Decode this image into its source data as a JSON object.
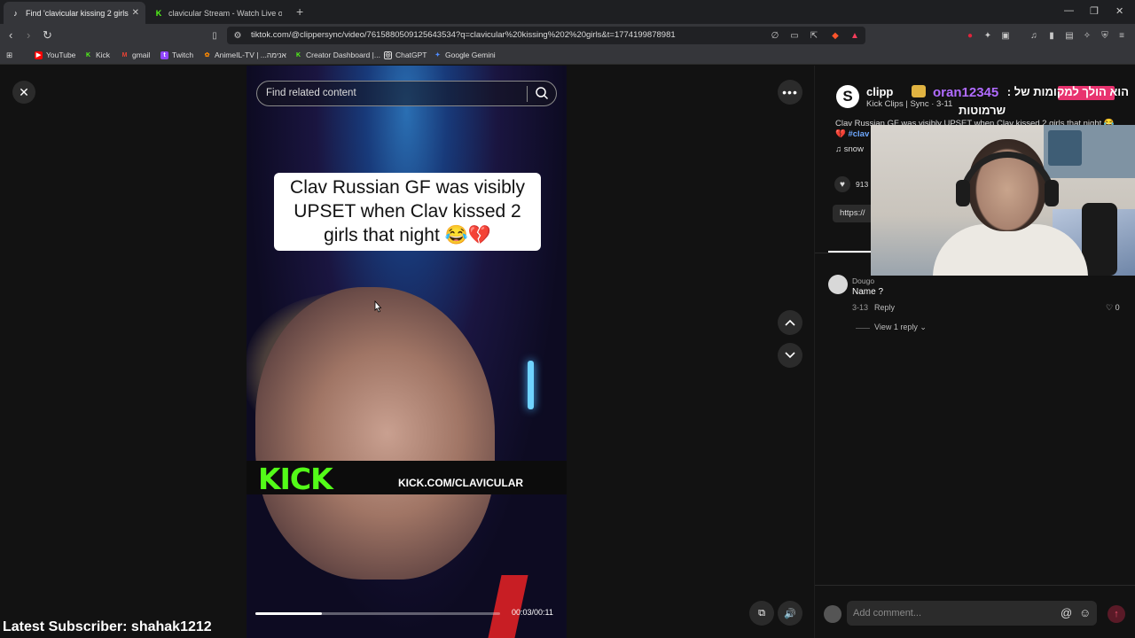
{
  "browser": {
    "tabs": [
      {
        "title": "Find 'clavicular kissing 2 girls",
        "active": true,
        "icon": "tiktok-icon"
      },
      {
        "title": "clavicular Stream - Watch Live on Kic",
        "active": false,
        "icon": "kick-icon"
      }
    ],
    "url": "tiktok.com/@clippersync/video/7615880509125643534?q=clavicular%20kissing%202%20girls&t=1774199878981",
    "bookmarks": [
      {
        "label": "YouTube",
        "icon": "youtube-icon",
        "color": "#ff0000"
      },
      {
        "label": "Kick",
        "icon": "kick-icon",
        "color": "#53fc18"
      },
      {
        "label": "gmail",
        "icon": "gmail-icon",
        "color": "#ea4335"
      },
      {
        "label": "Twitch",
        "icon": "twitch-icon",
        "color": "#9146ff"
      },
      {
        "label": "AnimeIL-TV | ...אנימה",
        "icon": "animeil-icon",
        "color": "#ff8a00"
      },
      {
        "label": "Creator Dashboard |...",
        "icon": "kick-icon",
        "color": "#53fc18"
      },
      {
        "label": "ChatGPT",
        "icon": "chatgpt-icon",
        "color": "#ffffff"
      },
      {
        "label": "Google Gemini",
        "icon": "gemini-icon",
        "color": "#4f8cff"
      }
    ]
  },
  "video": {
    "search_placeholder": "Find related content",
    "caption": "Clav Russian GF was visibly UPSET when Clav kissed 2 girls that night 😂💔",
    "kick_logo": "KICK",
    "kick_url": "KICK.COM/CLAVICULAR",
    "time": "00:03/00:11",
    "progress_fraction": 0.27
  },
  "overlay": {
    "latest_subscriber": "Latest Subscriber: shahak1212"
  },
  "post": {
    "author": "clipp",
    "meta": "Kick Clips | Sync · 3-11",
    "description": "Clav Russian GF was visibly UPSET when Clav kissed 2 girls that night 😂",
    "hashtag": "💔 #clav",
    "music": "♫ snow",
    "likes": "913",
    "link": "https://"
  },
  "stream_overlay": {
    "username": "oran12345",
    "hebrew_line1": "הוא הולך למקומות של :",
    "hebrew_line2": "שרמוטות"
  },
  "comments": [
    {
      "user": "Dougo",
      "text": "Name ?",
      "date": "3-13",
      "reply_label": "Reply",
      "likes": "0",
      "view_replies": "View 1 reply"
    }
  ],
  "comment_bar": {
    "placeholder": "Add comment..."
  },
  "colors": {
    "accent": "#fe2c55",
    "kick_green": "#53fc18"
  }
}
